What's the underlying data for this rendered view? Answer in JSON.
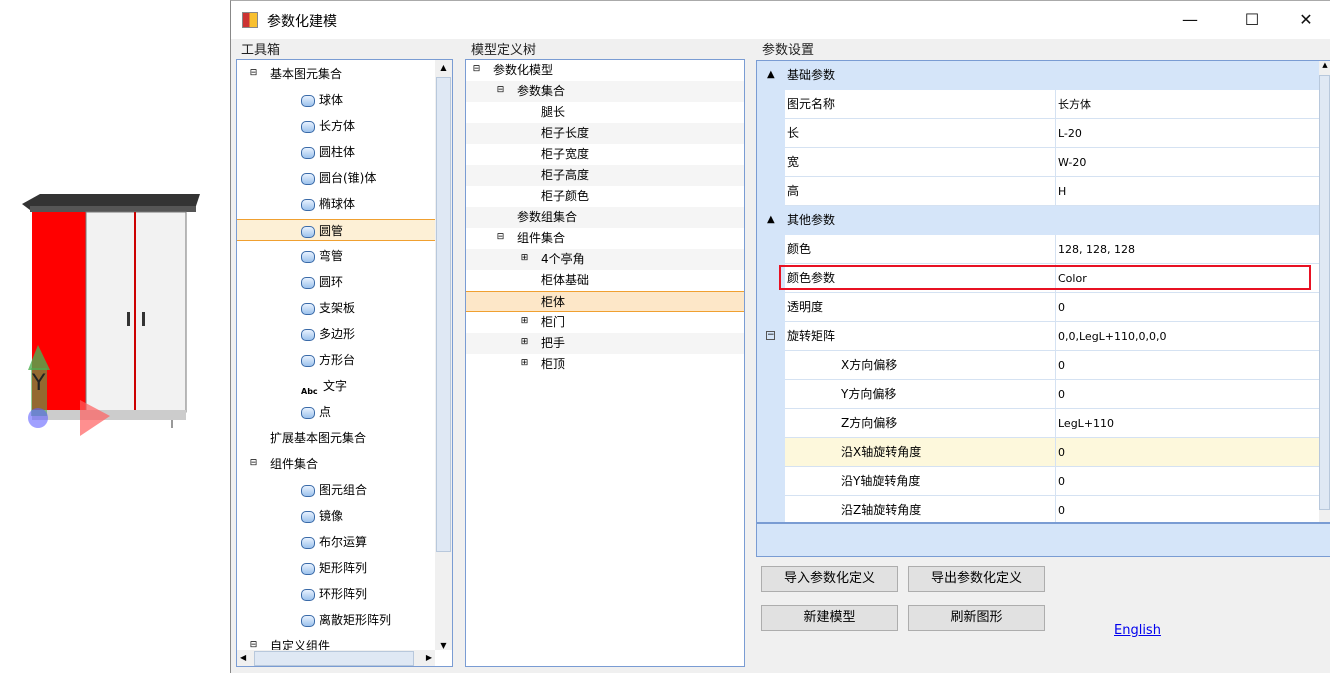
{
  "window": {
    "title": "参数化建模",
    "minimize": "—",
    "maximize": "☐",
    "close": "✕"
  },
  "toolbox": {
    "label": "工具箱",
    "items": [
      {
        "label": "基本图元集合",
        "level": 0,
        "expander": "⊟"
      },
      {
        "label": "球体",
        "level": 1,
        "icon": "sphere-icon"
      },
      {
        "label": "长方体",
        "level": 1,
        "icon": "box-icon"
      },
      {
        "label": "圆柱体",
        "level": 1,
        "icon": "cylinder-icon"
      },
      {
        "label": "圆台(锥)体",
        "level": 1,
        "icon": "cone-icon"
      },
      {
        "label": "椭球体",
        "level": 1,
        "icon": "ellipsoid-icon"
      },
      {
        "label": "圆管",
        "level": 1,
        "icon": "pipe-icon",
        "selected": true
      },
      {
        "label": "弯管",
        "level": 1,
        "icon": "elbow-icon"
      },
      {
        "label": "圆环",
        "level": 1,
        "icon": "torus-icon"
      },
      {
        "label": "支架板",
        "level": 1,
        "icon": "plate-icon"
      },
      {
        "label": "多边形",
        "level": 1,
        "icon": "polygon-icon"
      },
      {
        "label": "方形台",
        "level": 1,
        "icon": "frustum-icon"
      },
      {
        "label": "文字",
        "level": 1,
        "icon": "text-icon"
      },
      {
        "label": "点",
        "level": 1,
        "icon": "point-icon"
      },
      {
        "label": "扩展基本图元集合",
        "level": 0,
        "expander": ""
      },
      {
        "label": "组件集合",
        "level": 0,
        "expander": "⊟"
      },
      {
        "label": "图元组合",
        "level": 1,
        "icon": "combine-icon"
      },
      {
        "label": "镜像",
        "level": 1,
        "icon": "mirror-icon"
      },
      {
        "label": "布尔运算",
        "level": 1,
        "icon": "boolean-icon"
      },
      {
        "label": "矩形阵列",
        "level": 1,
        "icon": "rect-array-icon"
      },
      {
        "label": "环形阵列",
        "level": 1,
        "icon": "ring-array-icon"
      },
      {
        "label": "离散矩形阵列",
        "level": 1,
        "icon": "discrete-array-icon"
      },
      {
        "label": "自定义组件",
        "level": 0,
        "expander": "⊟"
      }
    ],
    "text_icon_glyph": "Abc"
  },
  "model_tree": {
    "label": "模型定义树",
    "items": [
      {
        "label": "参数化模型",
        "level": 0,
        "expander": "⊟"
      },
      {
        "label": "参数集合",
        "level": 1,
        "expander": "⊟"
      },
      {
        "label": "腿长",
        "level": 2
      },
      {
        "label": "柜子长度",
        "level": 2
      },
      {
        "label": "柜子宽度",
        "level": 2
      },
      {
        "label": "柜子高度",
        "level": 2
      },
      {
        "label": "柜子颜色",
        "level": 2
      },
      {
        "label": "参数组集合",
        "level": 1
      },
      {
        "label": "组件集合",
        "level": 1,
        "expander": "⊟"
      },
      {
        "label": "4个亭角",
        "level": 2,
        "expander": "⊞"
      },
      {
        "label": "柜体基础",
        "level": 2
      },
      {
        "label": "柜体",
        "level": 2,
        "selected": true
      },
      {
        "label": "柜门",
        "level": 2,
        "expander": "⊞"
      },
      {
        "label": "把手",
        "level": 2,
        "expander": "⊞"
      },
      {
        "label": "柜顶",
        "level": 2,
        "expander": "⊞"
      }
    ]
  },
  "params": {
    "label": "参数设置",
    "categories": [
      {
        "name": "基础参数",
        "rows": [
          [
            "图元名称",
            "长方体"
          ],
          [
            "长",
            "L-20"
          ],
          [
            "宽",
            "W-20"
          ],
          [
            "高",
            "H"
          ]
        ]
      },
      {
        "name": "其他参数",
        "rows": [
          [
            "颜色",
            "128, 128, 128"
          ],
          [
            "颜色参数",
            "Color"
          ],
          [
            "透明度",
            "0"
          ],
          [
            "旋转矩阵",
            "0,0,LegL+110,0,0,0"
          ],
          [
            "X方向偏移",
            "0"
          ],
          [
            "Y方向偏移",
            "0"
          ],
          [
            "Z方向偏移",
            "LegL+110"
          ],
          [
            "沿X轴旋转角度",
            "0"
          ],
          [
            "沿Y轴旋转角度",
            "0"
          ],
          [
            "沿Z轴旋转角度",
            "0"
          ]
        ]
      }
    ],
    "highlight_color": "#e81123"
  },
  "buttons": {
    "import": "导入参数化定义",
    "export": "导出参数化定义",
    "new_model": "新建模型",
    "refresh": "刷新图形"
  },
  "link_english": "English",
  "viewport": {
    "axis_y": "Y"
  }
}
